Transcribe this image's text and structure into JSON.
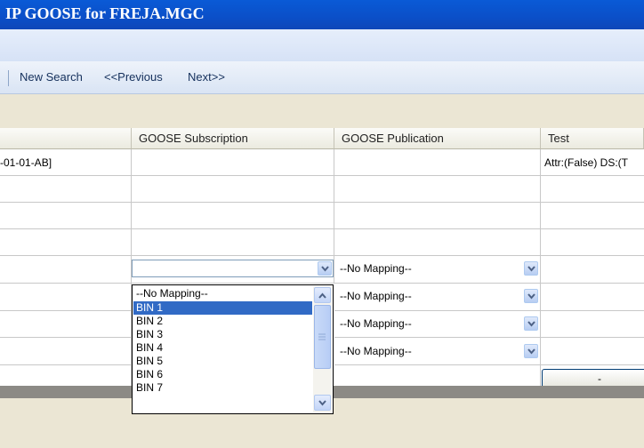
{
  "window": {
    "title": "IP GOOSE for FREJA.MGC"
  },
  "toolbar": {
    "new_search": "New Search",
    "previous": "<<Previous",
    "next": "Next>>"
  },
  "grid": {
    "headers": {
      "sub": "GOOSE Subscription",
      "pub": "GOOSE Publication",
      "test": "Test"
    },
    "row1": {
      "first": "-01-01-AB]",
      "test": "Attr:(False) DS:(T"
    },
    "pub_combos": [
      "--No Mapping--",
      "--No Mapping--",
      "--No Mapping--",
      "--No Mapping--"
    ],
    "sub_combo_value": "",
    "button_label": "-"
  },
  "dropdown": {
    "options": [
      "--No Mapping--",
      "BIN 1",
      "BIN 2",
      "BIN 3",
      "BIN 4",
      "BIN 5",
      "BIN 6",
      "BIN 7"
    ],
    "selected": "BIN 1"
  },
  "colors": {
    "title_blue": "#0b4fc8",
    "selection": "#316ac5"
  },
  "icons": [
    "chevron-down-icon",
    "chevron-up-icon",
    "scroll-grip-icon"
  ]
}
